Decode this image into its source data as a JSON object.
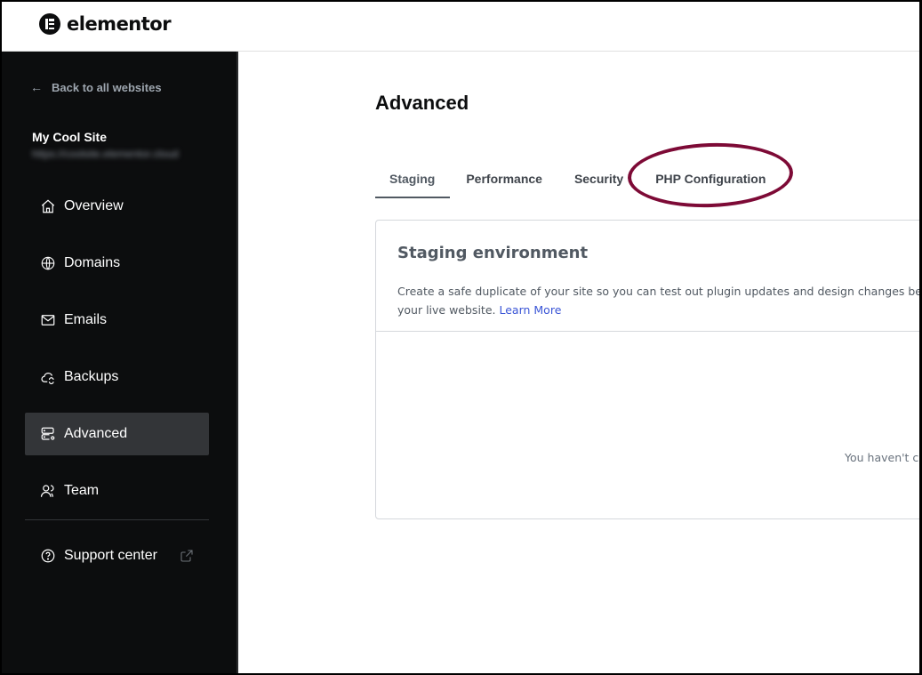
{
  "header": {
    "brand": "elementor",
    "logo_icon": "elementor-logo-icon"
  },
  "sidebar": {
    "back_label": "Back to all websites",
    "back_icon": "arrow-left-icon",
    "site_name": "My Cool Site",
    "site_url": "https://coolsite.elementor.cloud",
    "items": [
      {
        "label": "Overview",
        "icon": "home-icon",
        "active": false
      },
      {
        "label": "Domains",
        "icon": "globe-www-icon",
        "active": false
      },
      {
        "label": "Emails",
        "icon": "envelope-icon",
        "active": false
      },
      {
        "label": "Backups",
        "icon": "cloud-sync-icon",
        "active": false
      },
      {
        "label": "Advanced",
        "icon": "server-gear-icon",
        "active": true
      },
      {
        "label": "Team",
        "icon": "users-icon",
        "active": false
      }
    ],
    "support": {
      "label": "Support center",
      "icon": "question-circle-icon",
      "external_icon": "external-link-icon"
    }
  },
  "main": {
    "title": "Advanced",
    "tabs": [
      {
        "label": "Staging",
        "active": true
      },
      {
        "label": "Performance",
        "active": false
      },
      {
        "label": "Security",
        "active": false
      },
      {
        "label": "PHP Configuration",
        "active": false,
        "highlighted": true
      }
    ],
    "highlight_color": "#7d0a36",
    "card": {
      "title": "Staging environment",
      "description": "Create a safe duplicate of your site so you can test out plugin updates and design changes before they go live on your live website.",
      "description_visible": "Create a safe duplicate of your site so you can test out plugin updates and design changes befo",
      "description_line2": "your live website.",
      "learn_more": "Learn More",
      "empty_state": "You haven't cr"
    }
  }
}
